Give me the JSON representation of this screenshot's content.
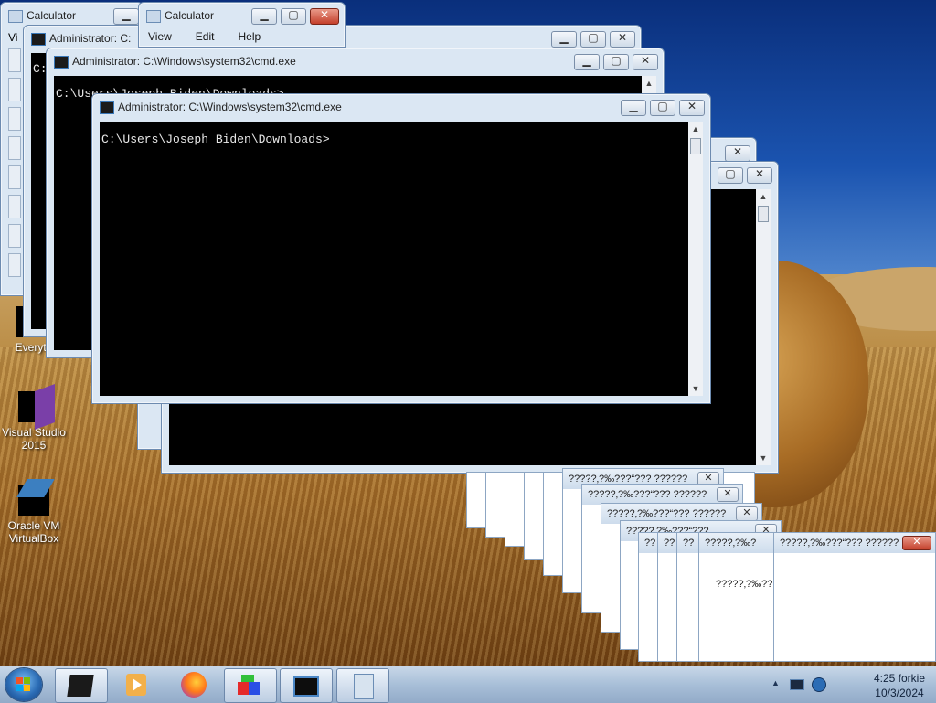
{
  "desktop": {
    "icons": [
      {
        "label": "Everyth"
      },
      {
        "label": "Visual Studio 2015"
      },
      {
        "label": "Oracle VM VirtualBox"
      }
    ]
  },
  "calculator": {
    "title_back": "Calculator",
    "title_front": "Calculator",
    "back_menu_fragment": "Vi",
    "menu": [
      "View",
      "Edit",
      "Help"
    ]
  },
  "cmd": {
    "title": "Administrator: C:\\Windows\\system32\\cmd.exe",
    "title_short": "Administrator: C:",
    "prompt": "C:\\Users\\Joseph Biden\\Downloads>",
    "prompt_partial": "C:\\",
    "prompt_cut": "C:\\Users\\Joseph Biden\\Downloads>"
  },
  "dialogs": {
    "title": "?????‚?‰???“??? ??????",
    "title_a": "?????‚?‰???“??? ??????",
    "title_b": "?????‚?‰???“??? ??????",
    "title_c": "?????‚?‰???“???",
    "title_d": "?????‚?‰?",
    "title_e": "??",
    "message": "?????‚?‰??",
    "message_front": "?????‚?‰???“??? ??????",
    "close": "✕"
  },
  "taskbar": {
    "time": "4:25 forkie",
    "date": "10/3/2024",
    "tray_arrow": "▲"
  },
  "colors": {
    "accent": "#2b6cb5",
    "close_red": "#c4402b",
    "console_bg": "#000000"
  }
}
